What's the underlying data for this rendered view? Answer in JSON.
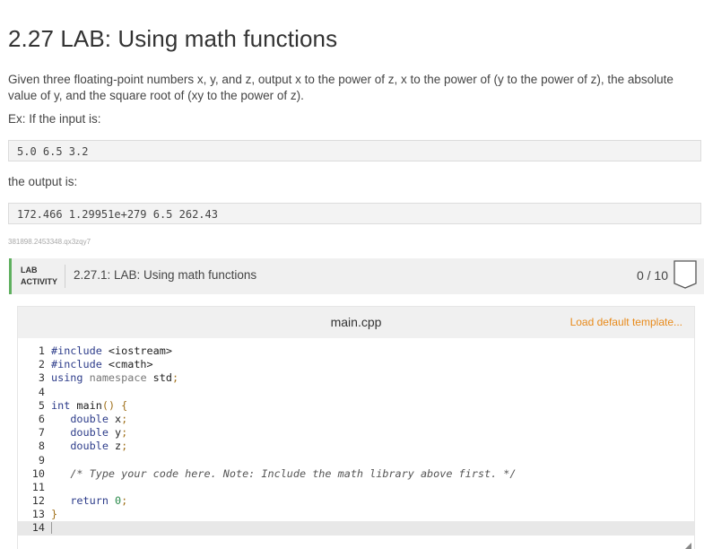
{
  "page": {
    "title": "2.27 LAB: Using math functions",
    "description": "Given three floating-point numbers x, y, and z, output x to the power of z, x to the power of (y to the power of z), the absolute value of y, and the square root of (xy to the power of z).",
    "example_label": "Ex: If the input is:",
    "example_input": "5.0 6.5 3.2",
    "output_label": "the output is:",
    "example_output": "172.466 1.29951e+279 6.5 262.43",
    "tracking_id": "381898.2453348.qx3zqy7"
  },
  "lab": {
    "tag_line1": "LAB",
    "tag_line2": "ACTIVITY",
    "title": "2.27.1: LAB: Using math functions",
    "score": "0 / 10",
    "accent_color": "#5fb05f"
  },
  "editor": {
    "file_name": "main.cpp",
    "load_template_label": "Load default template...",
    "lines": [
      {
        "n": "1",
        "tokens": [
          [
            "k-pre",
            "#include "
          ],
          [
            "k-id",
            "<iostream>"
          ]
        ]
      },
      {
        "n": "2",
        "tokens": [
          [
            "k-pre",
            "#include "
          ],
          [
            "k-id",
            "<cmath>"
          ]
        ]
      },
      {
        "n": "3",
        "tokens": [
          [
            "k-kw",
            "using "
          ],
          [
            "k-ns",
            "namespace "
          ],
          [
            "k-id",
            "std"
          ],
          [
            "k-punc",
            ";"
          ]
        ]
      },
      {
        "n": "4",
        "tokens": []
      },
      {
        "n": "5",
        "tokens": [
          [
            "k-type",
            "int "
          ],
          [
            "k-id",
            "main"
          ],
          [
            "k-punc",
            "() {"
          ]
        ]
      },
      {
        "n": "6",
        "tokens": [
          [
            "k-id",
            "   "
          ],
          [
            "k-type",
            "double "
          ],
          [
            "k-id",
            "x"
          ],
          [
            "k-punc",
            ";"
          ]
        ]
      },
      {
        "n": "7",
        "tokens": [
          [
            "k-id",
            "   "
          ],
          [
            "k-type",
            "double "
          ],
          [
            "k-id",
            "y"
          ],
          [
            "k-punc",
            ";"
          ]
        ]
      },
      {
        "n": "8",
        "tokens": [
          [
            "k-id",
            "   "
          ],
          [
            "k-type",
            "double "
          ],
          [
            "k-id",
            "z"
          ],
          [
            "k-punc",
            ";"
          ]
        ]
      },
      {
        "n": "9",
        "tokens": []
      },
      {
        "n": "10",
        "tokens": [
          [
            "k-id",
            "   "
          ],
          [
            "k-cmt",
            "/* Type your code here. Note: Include the math library above first. */"
          ]
        ]
      },
      {
        "n": "11",
        "tokens": []
      },
      {
        "n": "12",
        "tokens": [
          [
            "k-id",
            "   "
          ],
          [
            "k-kw",
            "return "
          ],
          [
            "k-num",
            "0"
          ],
          [
            "k-punc",
            ";"
          ]
        ]
      },
      {
        "n": "13",
        "tokens": [
          [
            "k-punc",
            "}"
          ]
        ]
      },
      {
        "n": "14",
        "tokens": [],
        "active": true
      }
    ]
  }
}
